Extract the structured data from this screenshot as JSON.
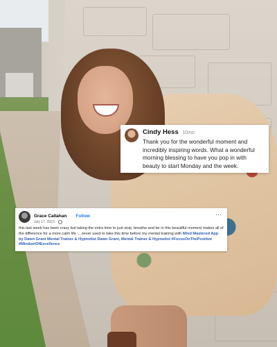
{
  "comment": {
    "author": "Cindy Hess",
    "time": "10mo",
    "text": "Thank you for the wonderful moment and incredibly inspiring words. What a wonderful morning blessing to have you pop in with beauty to start Monday and the week."
  },
  "post": {
    "author": "Grace Callahan",
    "separator": "·",
    "follow": "Follow",
    "date": "July 17, 2023 ·",
    "more": "···",
    "text_plain": "this last week has been crazy but taking the extra time to just stop, breathe and be in this beautiful moment makes all of the difference for a more calm life ... never used to take this time before my mental training with",
    "link_text": "Mind Mastered App by Dawn Grant Mental Trainer & Hypnotist Dawn Grant, Mental Trainer & Hypnotist",
    "hashtags": "#FocusOnThePositive #MindsetOfExcellence"
  },
  "icons": {
    "comment_avatar": "avatar",
    "post_avatar": "avatar",
    "privacy": "globe-icon",
    "menu": "more-options-icon"
  },
  "colors": {
    "link": "#2a5bb7",
    "follow": "#1877f2"
  }
}
